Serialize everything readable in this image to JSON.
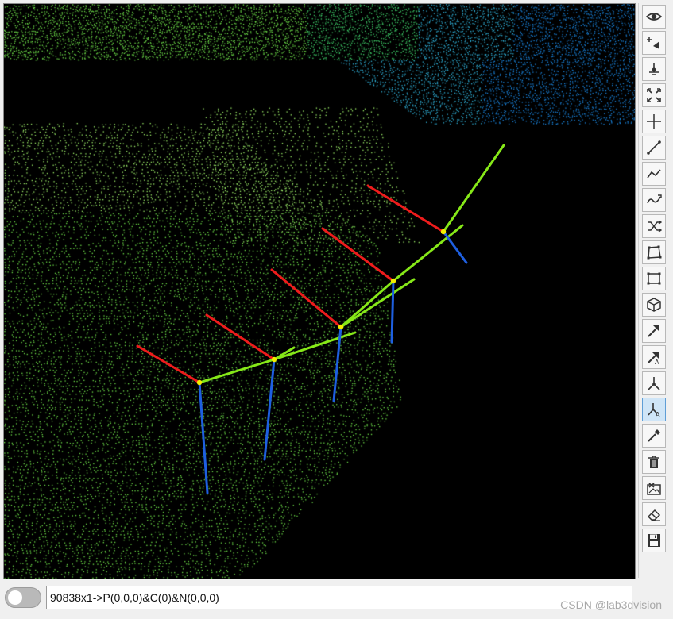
{
  "viewport": {
    "background": "#000000",
    "point_palette": [
      "#9ef06a",
      "#6fe24a",
      "#3fd06a",
      "#2fb0d8",
      "#1a86e0"
    ],
    "section_colors": {
      "red": "#ee1c1c",
      "green": "#86e818",
      "blue": "#1e5fe0",
      "node": "#f2ee00"
    }
  },
  "toolbar": {
    "tools": [
      {
        "name": "eye-icon",
        "active": false
      },
      {
        "name": "add-point-icon",
        "active": false
      },
      {
        "name": "anchor-icon",
        "active": false
      },
      {
        "name": "fit-all-icon",
        "active": false
      },
      {
        "name": "crosshair-icon",
        "active": false
      },
      {
        "name": "line-icon",
        "active": false
      },
      {
        "name": "polyline-icon",
        "active": false
      },
      {
        "name": "curve-icon",
        "active": false
      },
      {
        "name": "shuffle-icon",
        "active": false
      },
      {
        "name": "polygon-icon",
        "active": false
      },
      {
        "name": "rectangle-icon",
        "active": false
      },
      {
        "name": "cube-icon",
        "active": false
      },
      {
        "name": "arrow-icon",
        "active": false
      },
      {
        "name": "arrow-label-icon",
        "active": false
      },
      {
        "name": "axis-icon",
        "active": false
      },
      {
        "name": "axis-label-icon",
        "active": true
      },
      {
        "name": "picker-icon",
        "active": false
      },
      {
        "name": "trash-icon",
        "active": false
      },
      {
        "name": "clear-image-icon",
        "active": false
      },
      {
        "name": "eraser-icon",
        "active": false
      },
      {
        "name": "save-icon",
        "active": false
      }
    ]
  },
  "statusbar": {
    "command_text": "90838x1->P(0,0,0)&C(0)&N(0,0,0)",
    "watermark": "CSDN @lab3dvision"
  }
}
